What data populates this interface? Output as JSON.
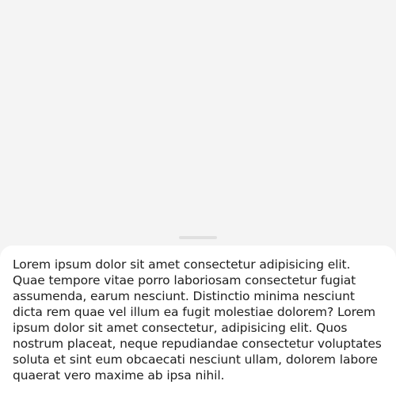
{
  "bottom_sheet": {
    "body_text": "Lorem ipsum dolor sit amet consectetur adipisicing elit. Quae tempore vitae porro laboriosam consectetur fugiat assumenda, earum nesciunt. Distinctio minima nesciunt dicta rem quae vel illum ea fugit molestiae dolorem? Lorem ipsum dolor sit amet consectetur, adipisicing elit. Quos nostrum placeat, neque repudiandae consectetur voluptates soluta et sint eum obcaecati nesciunt ullam, dolorem labore quaerat vero maxime ab ipsa nihil."
  },
  "colors": {
    "background": "#f4f4f4",
    "sheet": "#ffffff",
    "handle": "#e0e0e0",
    "text": "#1f1f1f"
  }
}
